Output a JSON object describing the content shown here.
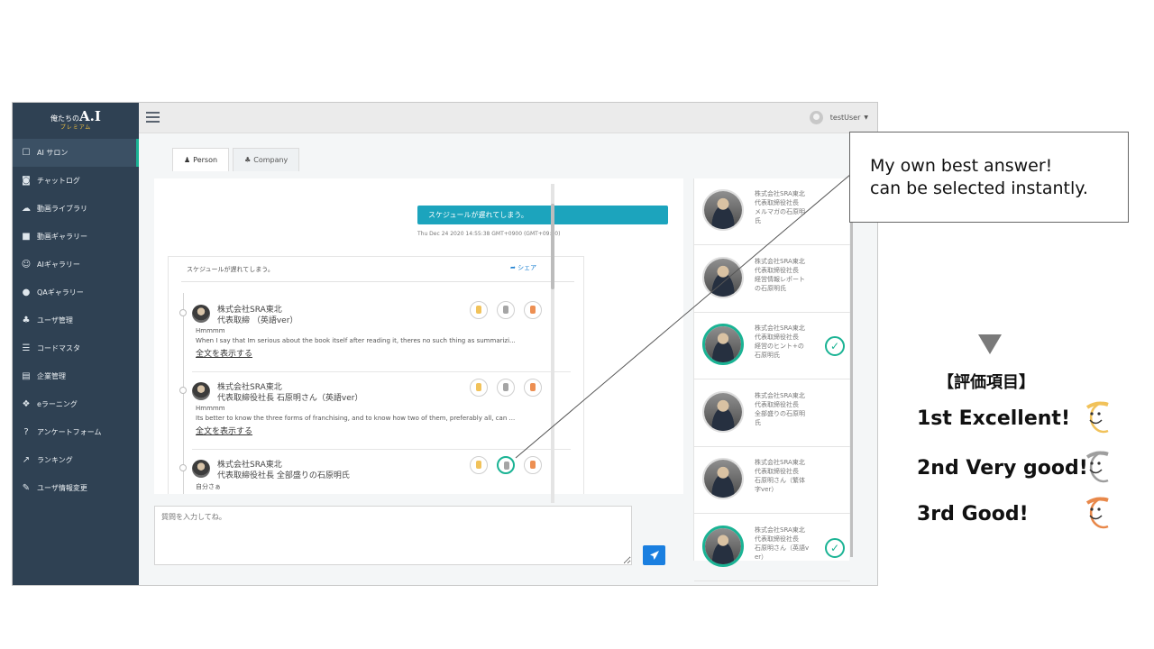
{
  "app": {
    "brand": {
      "title_prefix": "俺たちの",
      "title_main": "A.I",
      "subtitle": "プレミアム"
    },
    "sidebar": {
      "items": [
        {
          "icon": "comment-icon",
          "glyph": "☐",
          "label": "AI サロン",
          "active": true
        },
        {
          "icon": "chat-icon",
          "glyph": "◙",
          "label": "チャットログ"
        },
        {
          "icon": "cloud-upload-icon",
          "glyph": "☁",
          "label": "動画ライブラリ"
        },
        {
          "icon": "video-camera-icon",
          "glyph": "■",
          "label": "動画ギャラリー"
        },
        {
          "icon": "smile-icon",
          "glyph": "☺",
          "label": "AIギャラリー"
        },
        {
          "icon": "globe-icon",
          "glyph": "●",
          "label": "QAギャラリー"
        },
        {
          "icon": "users-icon",
          "glyph": "♣",
          "label": "ユーザ管理"
        },
        {
          "icon": "list-icon",
          "glyph": "☰",
          "label": "コードマスタ"
        },
        {
          "icon": "building-icon",
          "glyph": "▤",
          "label": "企業管理"
        },
        {
          "icon": "cubes-icon",
          "glyph": "❖",
          "label": "eラーニング"
        },
        {
          "icon": "question-icon",
          "glyph": "?",
          "label": "アンケートフォーム"
        },
        {
          "icon": "chart-line-icon",
          "glyph": "↗",
          "label": "ランキング"
        },
        {
          "icon": "edit-icon",
          "glyph": "✎",
          "label": "ユーザ情報変更"
        }
      ]
    },
    "topbar": {
      "username": "testUser"
    },
    "tabs": [
      {
        "icon": "person-icon",
        "glyph": "♟",
        "label": "Person",
        "active": true
      },
      {
        "icon": "company-icon",
        "glyph": "♣",
        "label": "Company"
      }
    ],
    "chat": {
      "question": "スケジュールが遅れてしまう。",
      "timestamp": "Thu Dec 24 2020 14:55:38 GMT+0900 (GMT+09:00)",
      "card_question": "スケジュールが遅れてしまう。",
      "share_label": "シェア",
      "answers": [
        {
          "line1": "株式会社SRA東北",
          "line2": "代表取締                    （英語ver）",
          "line3": "Hmmmm",
          "text": "When I say that Im serious about the book itself after reading it, theres no such thing as summarizi...",
          "more": "全文を表示する",
          "selected_rating": 0
        },
        {
          "line1": "株式会社SRA東北",
          "line2": "代表取締役社長 石原明さん（英語ver）",
          "line3": "Hmmmm",
          "text": "Its better to know the three forms of franchising, and to know how two of them, preferably all, can ...",
          "more": "全文を表示する",
          "selected_rating": 0
        },
        {
          "line1": "株式会社SRA東北",
          "line2": "代表取締役社長 全部盛りの石原明氏",
          "line3": "自分さぁ",
          "text": "",
          "more": "",
          "selected_rating": 2
        }
      ]
    },
    "input": {
      "placeholder": "質問を入力してね。"
    },
    "ai_list": [
      {
        "lines": "株式会社SRA東北\n代表取締役社長\nメルマガの石原明\n氏",
        "chosen": false
      },
      {
        "lines": "株式会社SRA東北\n代表取締役社長\n経営情報レポート\nの石原明氏",
        "chosen": false
      },
      {
        "lines": "株式会社SRA東北\n代表取締役社長\n経営のヒント+の\n石原明氏",
        "chosen": true
      },
      {
        "lines": "株式会社SRA東北\n代表取締役社長\n全部盛りの石原明\n氏",
        "chosen": false
      },
      {
        "lines": "株式会社SRA東北\n代表取締役社長\n石原明さん（繁体\n字ver）",
        "chosen": false
      },
      {
        "lines": "株式会社SRA東北\n代表取締役社長\n石原明さん（英語v\ner）",
        "chosen": true
      }
    ]
  },
  "annotations": {
    "callout_line1": "My own best answer!",
    "callout_line2": "can be selected instantly.",
    "eval_title": "【評価項目】",
    "eval_items": [
      {
        "label": "1st  Excellent!",
        "color": "#f1c25a"
      },
      {
        "label": "2nd Very good!",
        "color": "#9e9e9e"
      },
      {
        "label": "3rd Good!",
        "color": "#e8884a"
      }
    ]
  },
  "colors": {
    "sidebar": "#2f4153",
    "accent": "#1ab394",
    "message": "#1ca4bd",
    "send": "#1a7fe0"
  }
}
